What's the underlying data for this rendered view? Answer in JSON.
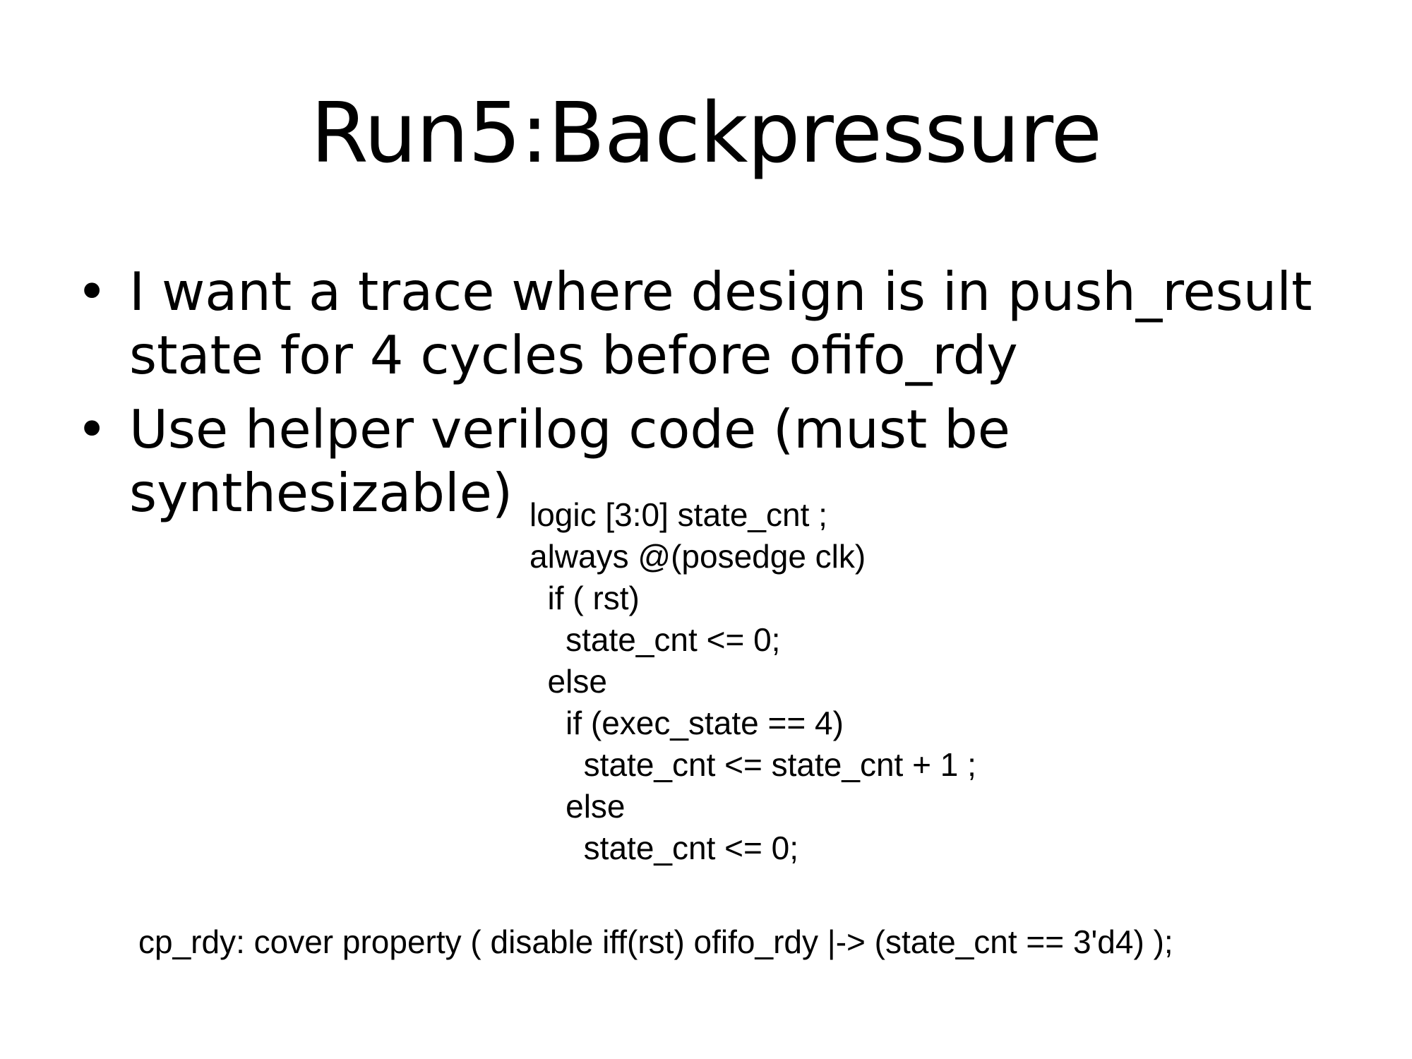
{
  "slide": {
    "title": "Run5:Backpressure",
    "bullets": [
      {
        "marker": "•",
        "text": "I want  a trace where design is in push_result state for 4 cycles before ofifo_rdy"
      },
      {
        "marker": "•",
        "text": "Use helper verilog code (must be synthesizable)"
      }
    ],
    "code_lines": [
      "logic [3:0] state_cnt ;",
      "always @(posedge clk)",
      "  if ( rst)",
      "    state_cnt <= 0;",
      "  else",
      "    if (exec_state == 4)",
      "      state_cnt <= state_cnt + 1 ;",
      "    else",
      "      state_cnt <= 0;"
    ],
    "cover_statement": "cp_rdy: cover property ( disable iff(rst) ofifo_rdy |-> (state_cnt == 3'd4) );"
  }
}
